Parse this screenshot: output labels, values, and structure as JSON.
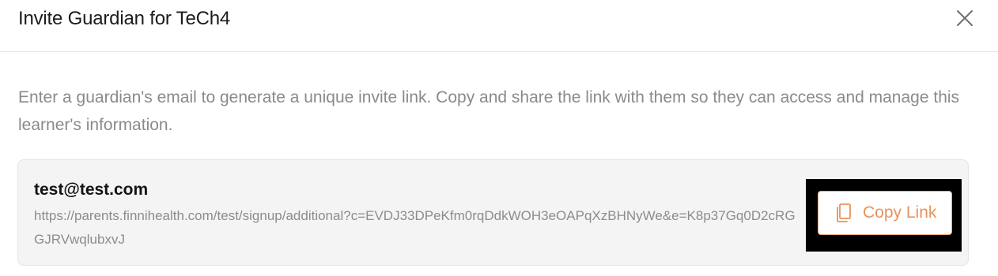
{
  "dialog": {
    "title": "Invite Guardian for TeCh4",
    "close_icon": "close-icon"
  },
  "description": "Enter a guardian's email to generate a unique invite link. Copy and share the link with them so they can access and manage this learner's information.",
  "invite": {
    "email": "test@test.com",
    "link": "https://parents.finnihealth.com/test/signup/additional?c=EVDJ33DPeKfm0rqDdkWOH3eOAPqXzBHNyWe&e=K8p37Gq0D2cRGGJRVwqlubxvJ",
    "copy_label": "Copy Link",
    "copy_icon": "copy-icon"
  },
  "colors": {
    "accent": "#e9925a",
    "muted_text": "#8a8a8a",
    "card_bg": "#f4f4f4"
  }
}
